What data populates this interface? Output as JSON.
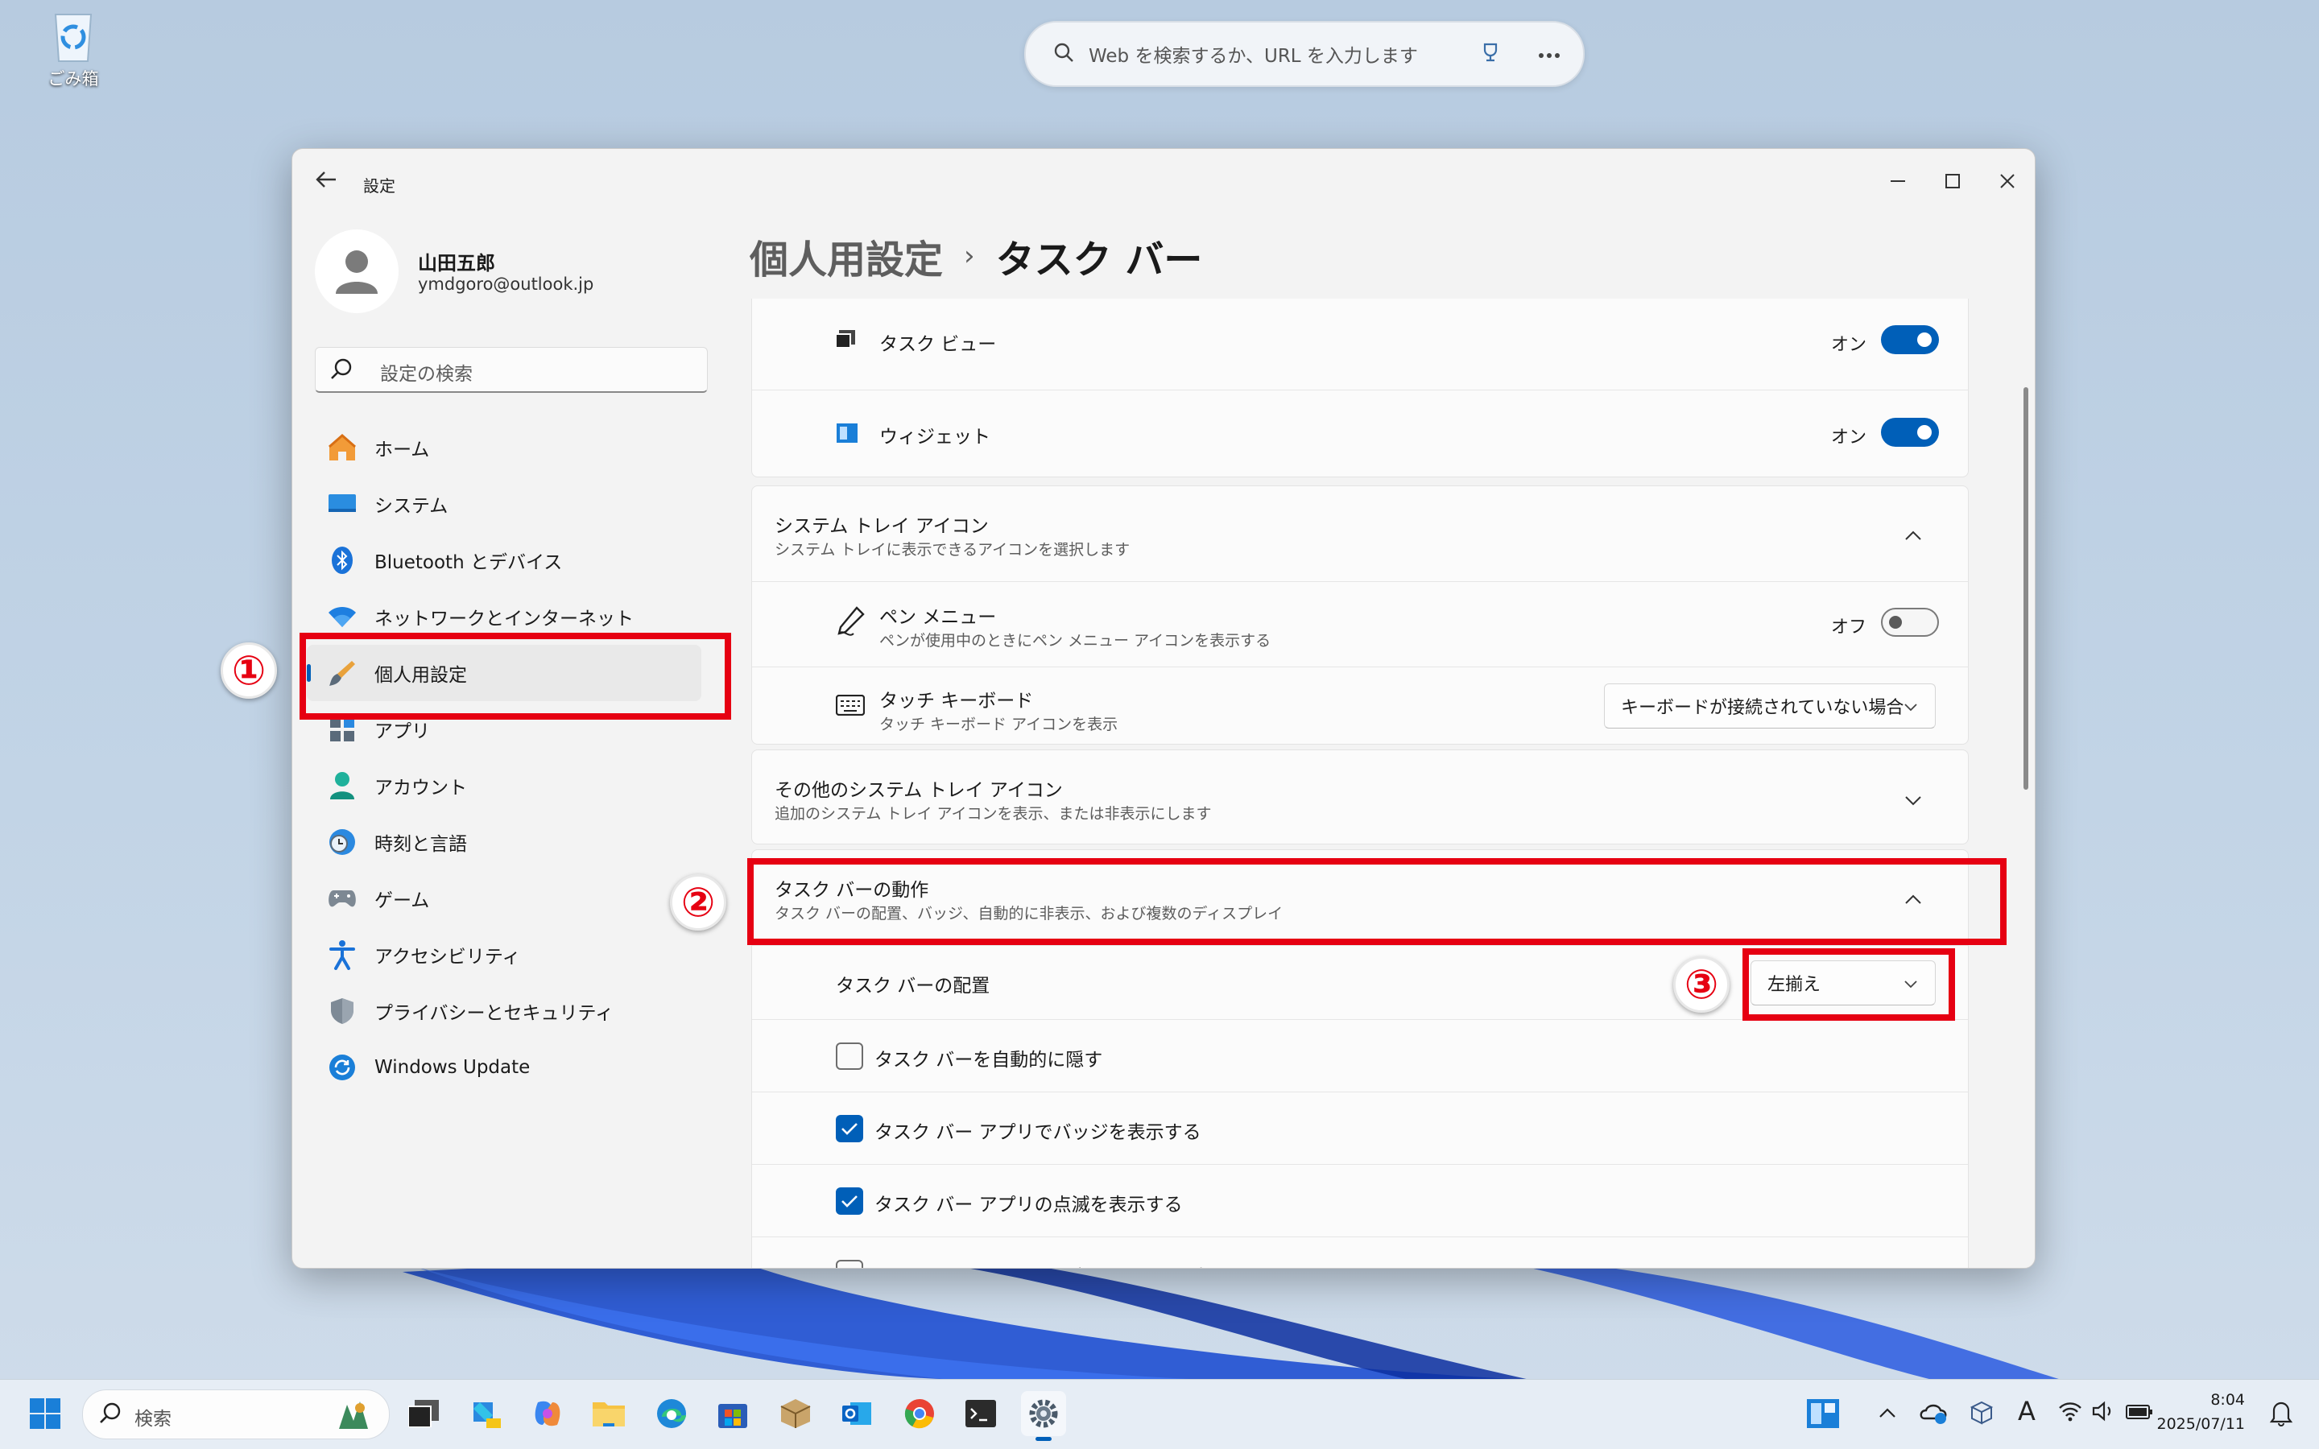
{
  "desktop": {
    "recycle_bin_label": "ごみ箱"
  },
  "browser_search": {
    "placeholder": "Web を検索するか、URL を入力します"
  },
  "window": {
    "title": "設定",
    "profile": {
      "name": "山田五郎",
      "email": "ymdgoro@outlook.jp"
    },
    "search_placeholder": "設定の検索",
    "nav": [
      {
        "label": "ホーム",
        "icon": "home-icon"
      },
      {
        "label": "システム",
        "icon": "system-icon"
      },
      {
        "label": "Bluetooth とデバイス",
        "icon": "bluetooth-icon"
      },
      {
        "label": "ネットワークとインターネット",
        "icon": "wifi-icon"
      },
      {
        "label": "個人用設定",
        "icon": "brush-icon",
        "active": true
      },
      {
        "label": "アプリ",
        "icon": "apps-icon"
      },
      {
        "label": "アカウント",
        "icon": "account-icon"
      },
      {
        "label": "時刻と言語",
        "icon": "clock-globe-icon"
      },
      {
        "label": "ゲーム",
        "icon": "gamepad-icon"
      },
      {
        "label": "アクセシビリティ",
        "icon": "accessibility-icon"
      },
      {
        "label": "プライバシーとセキュリティ",
        "icon": "shield-icon"
      },
      {
        "label": "Windows Update",
        "icon": "update-icon"
      }
    ],
    "breadcrumb": {
      "parent": "個人用設定",
      "separator": "›",
      "current": "タスク バー"
    },
    "content": {
      "task_view": {
        "label": "タスク ビュー",
        "state": "オン",
        "on": true
      },
      "widgets": {
        "label": "ウィジェット",
        "state": "オン",
        "on": true
      },
      "system_tray": {
        "title": "システム トレイ アイコン",
        "subtitle": "システム トレイに表示できるアイコンを選択します"
      },
      "pen_menu": {
        "label": "ペン メニュー",
        "subtitle": "ペンが使用中のときにペン メニュー アイコンを表示する",
        "state": "オフ",
        "on": false
      },
      "touch_keyboard": {
        "label": "タッチ キーボード",
        "subtitle": "タッチ キーボード アイコンを表示",
        "value": "キーボードが接続されていない場合"
      },
      "other_tray": {
        "title": "その他のシステム トレイ アイコン",
        "subtitle": "追加のシステム トレイ アイコンを表示、または非表示にします"
      },
      "behaviors": {
        "title": "タスク バーの動作",
        "subtitle": "タスク バーの配置、バッジ、自動的に非表示、および複数のディスプレイ"
      },
      "alignment": {
        "label": "タスク バーの配置",
        "value": "左揃え"
      },
      "auto_hide": {
        "label": "タスク バーを自動的に隠す",
        "checked": false
      },
      "badges": {
        "label": "タスク バー アプリでバッジを表示する",
        "checked": true
      },
      "flashing": {
        "label": "タスク バー アプリの点滅を表示する",
        "checked": true
      },
      "all_displays": {
        "label": "タスク バーをすべてのディスプレイに表示する",
        "checked": false
      }
    }
  },
  "annotations": {
    "n1": "①",
    "n2": "②",
    "n3": "③",
    "color": "#e60012"
  },
  "taskbar": {
    "search_placeholder": "検索",
    "time": "8:04",
    "date": "2025/07/11",
    "ime": "A"
  },
  "colors": {
    "accent": "#005fb8",
    "highlight": "#e60012"
  }
}
